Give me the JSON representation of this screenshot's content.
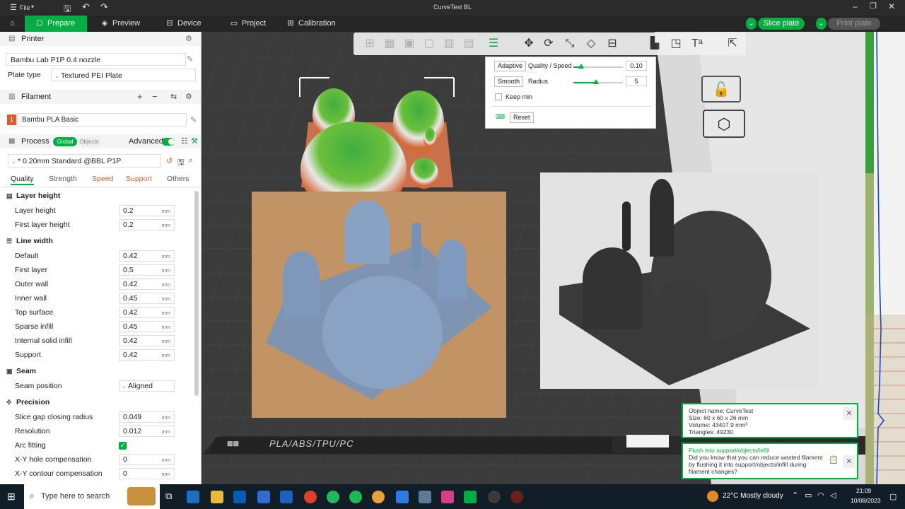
{
  "window": {
    "title": "CurveTest BL",
    "file_menu": "File"
  },
  "tabs": [
    {
      "label": "Prepare"
    },
    {
      "label": "Preview"
    },
    {
      "label": "Device"
    },
    {
      "label": "Project"
    },
    {
      "label": "Calibration"
    }
  ],
  "actions": {
    "slice": "Slice plate",
    "print": "Print plate"
  },
  "printer": {
    "section": "Printer",
    "name": "Bambu Lab P1P 0.4 nozzle",
    "plate_type_label": "Plate type",
    "plate_type": "Textured PEI Plate"
  },
  "filament": {
    "section": "Filament",
    "slot": "1",
    "name": "Bambu PLA Basic",
    "color": "#e05a2b"
  },
  "process": {
    "section": "Process",
    "toggle_global": "Global",
    "toggle_objects": "Objects",
    "advanced": "Advanced",
    "preset": "* 0.20mm Standard @BBL P1P"
  },
  "subtabs": [
    "Quality",
    "Strength",
    "Speed",
    "Support",
    "Others"
  ],
  "groups": {
    "layer_height": {
      "title": "Layer height",
      "rows": [
        {
          "label": "Layer height",
          "value": "0.2",
          "unit": "mm"
        },
        {
          "label": "First layer height",
          "value": "0.2",
          "unit": "mm"
        }
      ]
    },
    "line_width": {
      "title": "Line width",
      "rows": [
        {
          "label": "Default",
          "value": "0.42",
          "unit": "mm"
        },
        {
          "label": "First layer",
          "value": "0.5",
          "unit": "mm"
        },
        {
          "label": "Outer wall",
          "value": "0.42",
          "unit": "mm"
        },
        {
          "label": "Inner wall",
          "value": "0.45",
          "unit": "mm"
        },
        {
          "label": "Top surface",
          "value": "0.42",
          "unit": "mm"
        },
        {
          "label": "Sparse infill",
          "value": "0.45",
          "unit": "mm"
        },
        {
          "label": "Internal solid infill",
          "value": "0.42",
          "unit": "mm"
        },
        {
          "label": "Support",
          "value": "0.42",
          "unit": "mm"
        }
      ]
    },
    "seam": {
      "title": "Seam",
      "rows": [
        {
          "label": "Seam position",
          "value": "Aligned"
        }
      ]
    },
    "precision": {
      "title": "Precision",
      "rows": [
        {
          "label": "Slice gap closing radius",
          "value": "0.049",
          "unit": "mm"
        },
        {
          "label": "Resolution",
          "value": "0.012",
          "unit": "mm"
        },
        {
          "label": "Arc fitting",
          "value": ""
        },
        {
          "label": "X-Y hole compensation",
          "value": "0",
          "unit": "mm"
        },
        {
          "label": "X-Y contour compensation",
          "value": "0",
          "unit": "mm"
        }
      ]
    }
  },
  "adaptive": {
    "adaptive_btn": "Adaptive",
    "quality_label": "Quality / Speed",
    "quality_value": "0.10",
    "smooth_btn": "Smooth",
    "radius_label": "Radius",
    "radius_value": "5",
    "keep_min": "Keep min",
    "reset": "Reset"
  },
  "plate_label": "PLA/ABS/TPU/PC",
  "object_info": {
    "name": "Object name: CurveTest",
    "size": "Size: 60 x 60 x 26 mm",
    "volume": "Volume: 43407.9 mm³",
    "triangles": "Triangles: 49230"
  },
  "tip": {
    "title": "Flush into support/objects/infill",
    "body": "Did you know that you can reduce wasted filament by flushing it into support/objects/infill during filament changes?"
  },
  "taskbar": {
    "search": "Type here to search",
    "weather": "22°C  Mostly cloudy",
    "time": "21:09",
    "date": "10/08/2023"
  },
  "colors": {
    "accent": "#00ae42",
    "taskbar": "#111d27"
  }
}
